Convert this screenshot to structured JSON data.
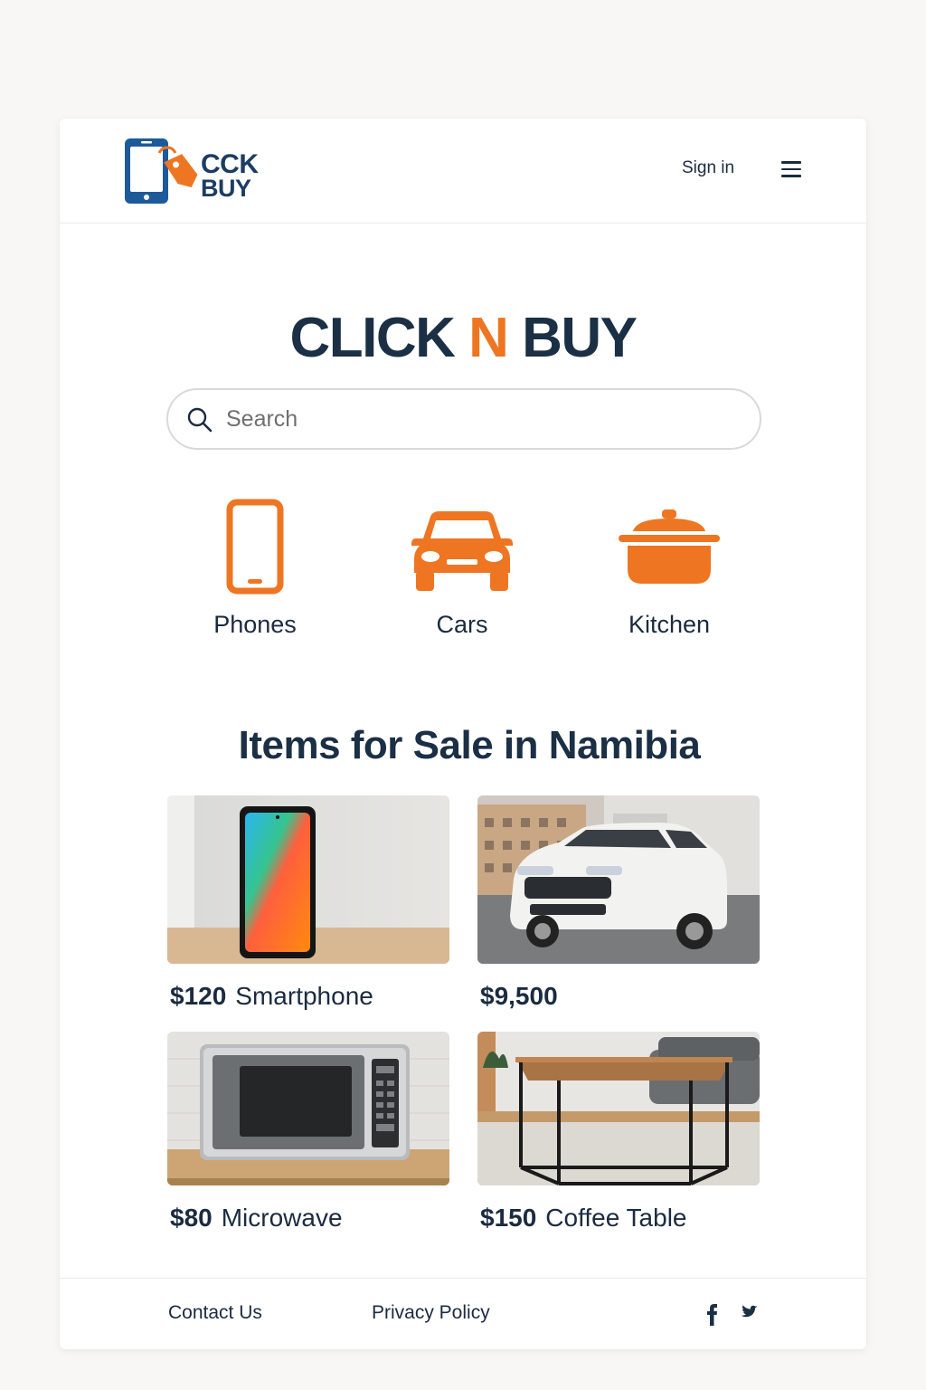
{
  "header": {
    "logo_line1": "CCK",
    "logo_line2": "BUY",
    "signin_label": "Sign in",
    "menu_icon": "hamburger-menu-icon"
  },
  "hero": {
    "title_part1": "CLICK ",
    "title_accent": "N",
    "title_part2": " BUY",
    "search_placeholder": "Search"
  },
  "categories": [
    {
      "label": "Phones",
      "icon": "phone-icon"
    },
    {
      "label": "Cars",
      "icon": "car-icon"
    },
    {
      "label": "Kitchen",
      "icon": "pot-icon"
    }
  ],
  "listings": {
    "title": "Items for Sale in Namibia",
    "items": [
      {
        "price": "$120",
        "name": "Smartphone"
      },
      {
        "price": "$9,500",
        "name": ""
      },
      {
        "price": "$80",
        "name": "Microwave"
      },
      {
        "price": "$150",
        "name": "Coffee Table"
      }
    ]
  },
  "footer": {
    "contact_label": "Contact Us",
    "privacy_label": "Privacy Policy",
    "social": [
      "facebook-icon",
      "twitter-icon"
    ]
  },
  "colors": {
    "accent": "#ee7622",
    "navy": "#1b2f45",
    "logo_blue": "#1c5a99"
  }
}
